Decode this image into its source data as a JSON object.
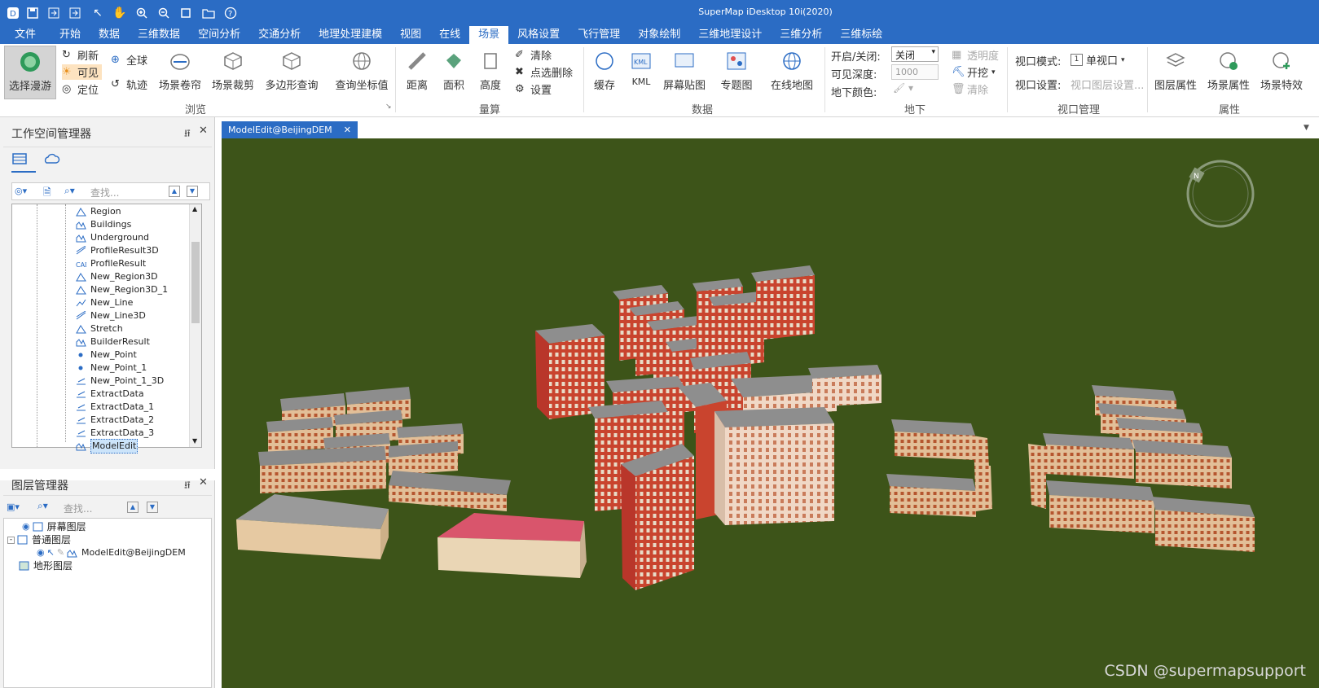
{
  "title": "SuperMap iDesktop 10i(2020)",
  "menu": [
    "文件",
    "开始",
    "数据",
    "三维数据",
    "空间分析",
    "交通分析",
    "地理处理建模",
    "视图",
    "在线",
    "场景",
    "风格设置",
    "飞行管理",
    "对象绘制",
    "三维地理设计",
    "三维分析",
    "三维标绘"
  ],
  "ribbon": {
    "browse": {
      "roam": "选择漫游",
      "refresh": "刷新",
      "visible": "可见",
      "locate": "定位",
      "globe": "全球",
      "track": "轨迹",
      "curtain": "场景卷帘",
      "clip": "场景裁剪",
      "polyquery": "多边形查询",
      "querycoord": "查询坐标值",
      "group": "浏览"
    },
    "measure": {
      "distance": "距离",
      "area": "面积",
      "height": "高度",
      "clear": "清除",
      "pickdelete": "点选删除",
      "settings": "设置",
      "group": "量算"
    },
    "data": {
      "cache": "缓存",
      "kml": "KML",
      "screen": "屏幕贴图",
      "thematic": "专题图",
      "online": "在线地图",
      "group": "数据"
    },
    "underground": {
      "onoff_label": "开启/关闭:",
      "onoff_value": "关闭",
      "depth_label": "可见深度:",
      "depth_value": "1000",
      "color_label": "地下颜色:",
      "transparency": "透明度",
      "excavate": "开挖",
      "clear": "清除",
      "group": "地下"
    },
    "viewport": {
      "mode_label": "视口模式:",
      "mode_value": "单视口",
      "settings_label": "视口设置:",
      "settings_value": "视口图层设置...",
      "group": "视口管理"
    },
    "props": {
      "layer": "图层属性",
      "scene": "场景属性",
      "effects": "场景特效",
      "group": "属性"
    }
  },
  "workspace": {
    "title": "工作空间管理器",
    "search": "查找...",
    "items": [
      "Region",
      "Buildings",
      "Underground",
      "ProfileResult3D",
      "ProfileResult",
      "New_Region3D",
      "New_Region3D_1",
      "New_Line",
      "New_Line3D",
      "Stretch",
      "BuilderResult",
      "New_Point",
      "New_Point_1",
      "New_Point_1_3D",
      "ExtractData",
      "ExtractData_1",
      "ExtractData_2",
      "ExtractData_3",
      "ModelEdit"
    ]
  },
  "layers": {
    "title": "图层管理器",
    "search": "查找...",
    "screen": "屏幕图层",
    "normal": "普通图层",
    "modeledit": "ModelEdit@BeijingDEM",
    "terrain": "地形图层"
  },
  "scene": {
    "tab": "ModelEdit@BeijingDEM",
    "watermark": "CSDN @supermapsupport"
  }
}
